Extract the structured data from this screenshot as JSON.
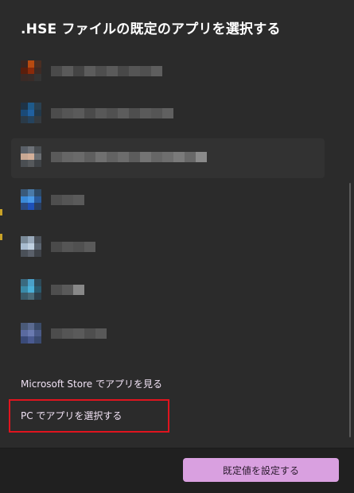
{
  "dialog": {
    "title": ".HSE ファイルの既定のアプリを選択する",
    "store_link": "Microsoft Store でアプリを見る",
    "pc_link": "PC でアプリを選択する",
    "set_default_button": "既定値を設定する"
  },
  "apps": [
    {
      "icon": [
        "#3a2520",
        "#b84a10",
        "#4a2e22",
        "#5a1e0c",
        "#8a2a0a",
        "#3e2a24",
        "#3a2a26",
        "#3a2c28",
        "#343434"
      ],
      "name": [
        "#4a4a4a",
        "#5a5a5a",
        "#444444",
        "#5c5c5c",
        "#4e4e4e",
        "#5a5a5a",
        "#484848",
        "#555555",
        "#505050",
        "#5e5e5e"
      ]
    },
    {
      "icon": [
        "#1e3346",
        "#1e5a8a",
        "#2a4050",
        "#1a4a78",
        "#2060a0",
        "#22384a",
        "#2a3a48",
        "#25435e",
        "#343a40"
      ],
      "name": [
        "#4c4c4c",
        "#555555",
        "#5a5a5a",
        "#4a4a4a",
        "#585858",
        "#505050",
        "#5c5c5c",
        "#4e4e4e",
        "#5a5a5a",
        "#555555",
        "#606060"
      ]
    },
    {
      "icon": [
        "#5a6068",
        "#6e7278",
        "#4a4e52",
        "#c8a894",
        "#d4b09a",
        "#6a6e72",
        "#4a4e52",
        "#56595c",
        "#3e4246"
      ],
      "name": [
        "#5a5a5a",
        "#666666",
        "#6a6a6a",
        "#5e5e5e",
        "#707070",
        "#626262",
        "#6c6c6c",
        "#5c5c5c",
        "#747474",
        "#666666",
        "#6e6e6e",
        "#7a7a7a",
        "#686868",
        "#8a8a8a"
      ]
    },
    {
      "icon": [
        "#3a5a7a",
        "#4a7aa8",
        "#2e4a66",
        "#3a8ad8",
        "#4a9ae8",
        "#2a5a9a",
        "#2a4a80",
        "#1e50b8",
        "#2a3e5e"
      ],
      "name": [
        "#4e4e4e",
        "#555555",
        "#5a5a5a"
      ]
    },
    {
      "icon": [
        "#7a8a98",
        "#9aaabb",
        "#4a5058",
        "#a8bcd0",
        "#c0d0e0",
        "#5a6470",
        "#4a5058",
        "#5a606a",
        "#3e4248"
      ],
      "name": [
        "#4a4a4a",
        "#555555",
        "#505050",
        "#5a5a5a"
      ]
    },
    {
      "icon": [
        "#3a6a80",
        "#4aa0c8",
        "#2e4a58",
        "#3a8aa8",
        "#4ab0d8",
        "#2a5a6e",
        "#3a5a68",
        "#4a6a78",
        "#2e3e48"
      ],
      "name": [
        "#4e4e4e",
        "#5a5a5a",
        "#888888"
      ]
    },
    {
      "icon": [
        "#4a5a78",
        "#5a6a90",
        "#3a4a68",
        "#5a6aa0",
        "#6a7ab0",
        "#4a5a88",
        "#3a4a78",
        "#4a5a90",
        "#3a4a70"
      ],
      "name": [
        "#4c4c4c",
        "#555555",
        "#5a5a5a",
        "#4e4e4e",
        "#585858"
      ]
    }
  ],
  "colors": {
    "accent": "#d9a0e0",
    "highlight_border": "#e0141e",
    "background": "#2b2b2b",
    "footer": "#202020"
  }
}
